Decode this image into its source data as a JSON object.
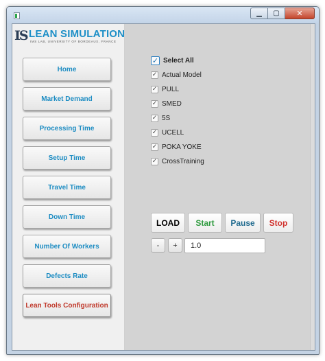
{
  "window": {
    "title": "",
    "buttons": {
      "minimize": "▁",
      "maximize": "▢",
      "close": "✕"
    }
  },
  "logo": {
    "mark": "IS",
    "title": "LEAN SIMULATION",
    "subtitle": "IMS LAB, UNIVERSITY OF BORDEAUX, FRANCE"
  },
  "sidebar": {
    "items": [
      {
        "label": "Home"
      },
      {
        "label": "Market Demand"
      },
      {
        "label": "Processing Time"
      },
      {
        "label": "Setup Time"
      },
      {
        "label": "Travel Time"
      },
      {
        "label": "Down Time"
      },
      {
        "label": "Number Of Workers"
      },
      {
        "label": "Defects Rate"
      },
      {
        "label": "Lean Tools Configuration"
      }
    ]
  },
  "checklist": {
    "select_all": {
      "label": "Select All",
      "checked": true
    },
    "items": [
      {
        "label": "Actual Model",
        "checked": true
      },
      {
        "label": "PULL",
        "checked": true
      },
      {
        "label": "SMED",
        "checked": true
      },
      {
        "label": "5S",
        "checked": true
      },
      {
        "label": "UCELL",
        "checked": true
      },
      {
        "label": "POKA YOKE",
        "checked": true
      },
      {
        "label": "CrossTraining",
        "checked": true
      }
    ]
  },
  "controls": {
    "load": "LOAD",
    "start": "Start",
    "pause": "Pause",
    "stop": "Stop",
    "decrease": "-",
    "increase": "+",
    "speed_value": "1.0"
  },
  "colors": {
    "nav_text": "#1e8dc3",
    "nav_active_text": "#c0392b",
    "start": "#2e9a3e",
    "pause": "#1f6a8e",
    "stop": "#d0312d",
    "load": "#000000"
  }
}
